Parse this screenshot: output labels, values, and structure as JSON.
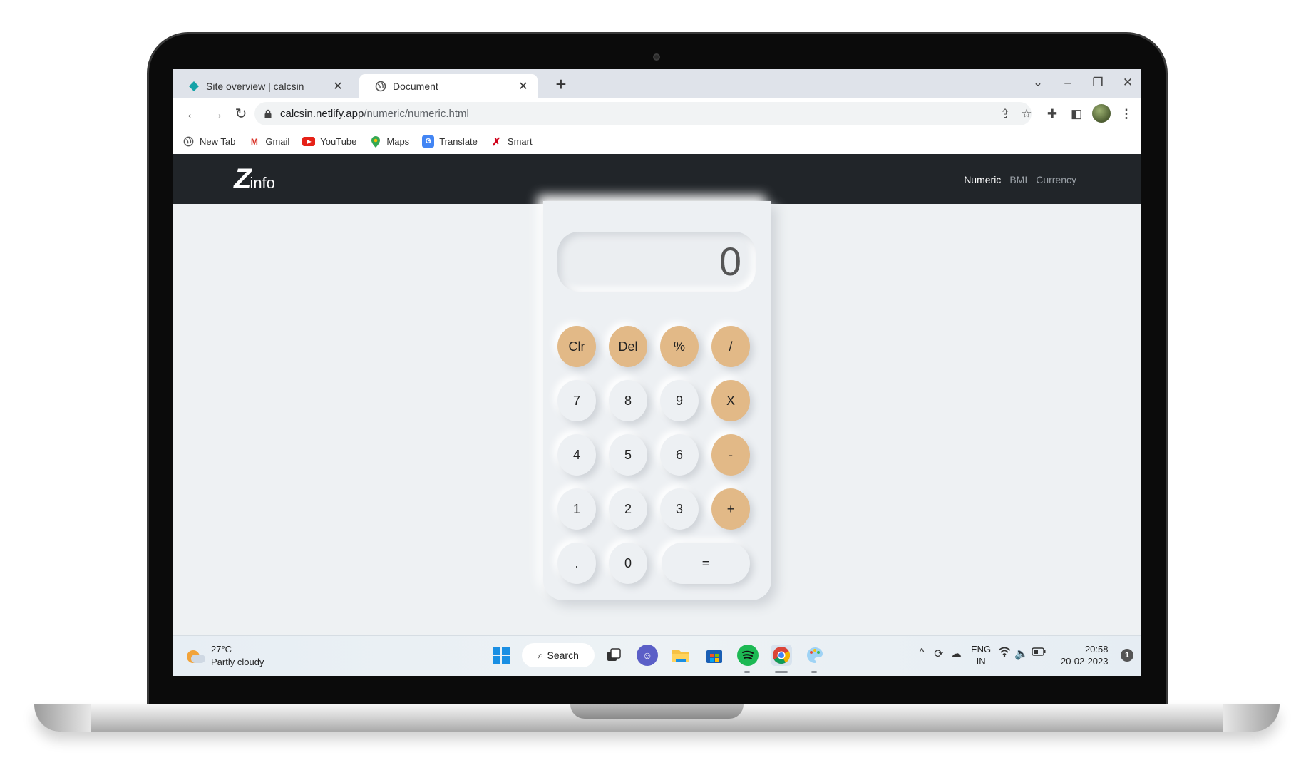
{
  "browser": {
    "tabs": [
      {
        "title": "Site overview | calcsin",
        "favicon": "netlify-diamond-icon"
      },
      {
        "title": "Document",
        "favicon": "globe-icon"
      }
    ],
    "new_tab": "+",
    "address": {
      "host": "calcsin.netlify.app",
      "path": "/numeric/numeric.html"
    },
    "bookmarks": [
      {
        "label": "New Tab",
        "icon": "globe-icon"
      },
      {
        "label": "Gmail",
        "icon": "gmail-icon"
      },
      {
        "label": "YouTube",
        "icon": "youtube-icon"
      },
      {
        "label": "Maps",
        "icon": "maps-icon"
      },
      {
        "label": "Translate",
        "icon": "translate-icon"
      },
      {
        "label": "Smart",
        "icon": "smart-icon"
      }
    ]
  },
  "site": {
    "logo_mark": "Z",
    "logo_text": "info",
    "nav": [
      {
        "label": "Numeric",
        "active": true
      },
      {
        "label": "BMI",
        "active": false
      },
      {
        "label": "Currency",
        "active": false
      }
    ]
  },
  "calculator": {
    "display": "0",
    "keys": {
      "clr": "Clr",
      "del": "Del",
      "percent": "%",
      "divide": "/",
      "seven": "7",
      "eight": "8",
      "nine": "9",
      "multiply": "X",
      "four": "4",
      "five": "5",
      "six": "6",
      "minus": "-",
      "one": "1",
      "two": "2",
      "three": "3",
      "plus": "+",
      "dot": ".",
      "zero": "0",
      "equals": "="
    },
    "colors": {
      "operator": "#e2b987",
      "surface": "#edf0f3"
    }
  },
  "taskbar": {
    "weather": {
      "temp": "27°C",
      "condition": "Partly cloudy"
    },
    "search": "Search",
    "lang": {
      "line1": "ENG",
      "line2": "IN"
    },
    "clock": {
      "time": "20:58",
      "date": "20-02-2023"
    },
    "notifications": "1"
  }
}
